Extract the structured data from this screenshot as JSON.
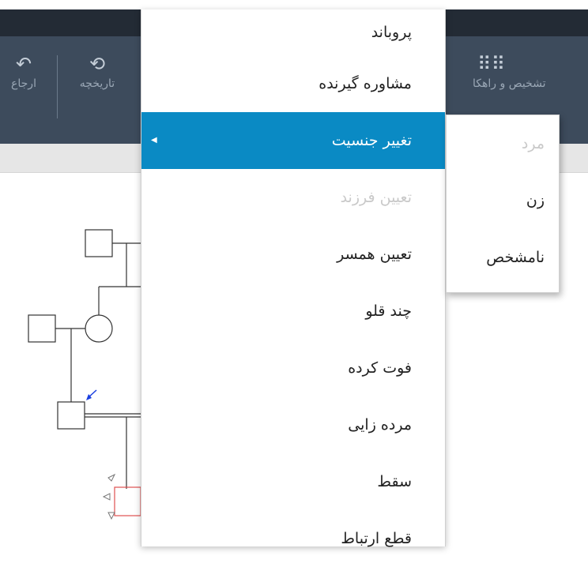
{
  "toolbar": {
    "history_label": "تاریخچه",
    "refer_label": "ارجاع",
    "diagnosis_label": "تشخیص و راهکا"
  },
  "menu": {
    "items": [
      {
        "label": "پروباند",
        "state": "normal"
      },
      {
        "label": "مشاوره گیرنده",
        "state": "normal"
      },
      {
        "label": "تغییر جنسیت",
        "state": "active"
      },
      {
        "label": "تعیین فرزند",
        "state": "disabled"
      },
      {
        "label": "تعیین همسر",
        "state": "normal"
      },
      {
        "label": "چند قلو",
        "state": "normal"
      },
      {
        "label": "فوت کرده",
        "state": "normal"
      },
      {
        "label": "مرده زایی",
        "state": "normal"
      },
      {
        "label": "سقط",
        "state": "normal"
      },
      {
        "label": "قطع ارتباط",
        "state": "normal"
      }
    ]
  },
  "submenu": {
    "items": [
      {
        "label": "مرد",
        "state": "disabled"
      },
      {
        "label": "زن",
        "state": "normal"
      },
      {
        "label": "نامشخص",
        "state": "normal"
      }
    ]
  },
  "colors": {
    "menu_active": "#0a8ac4",
    "toolbar": "#3d4b5c",
    "arrow_blue": "#1a3fe0",
    "selected_red": "#e05050"
  },
  "icons": [
    "undo-icon",
    "history-icon",
    "grid-icon",
    "submenu-arrow-icon"
  ]
}
